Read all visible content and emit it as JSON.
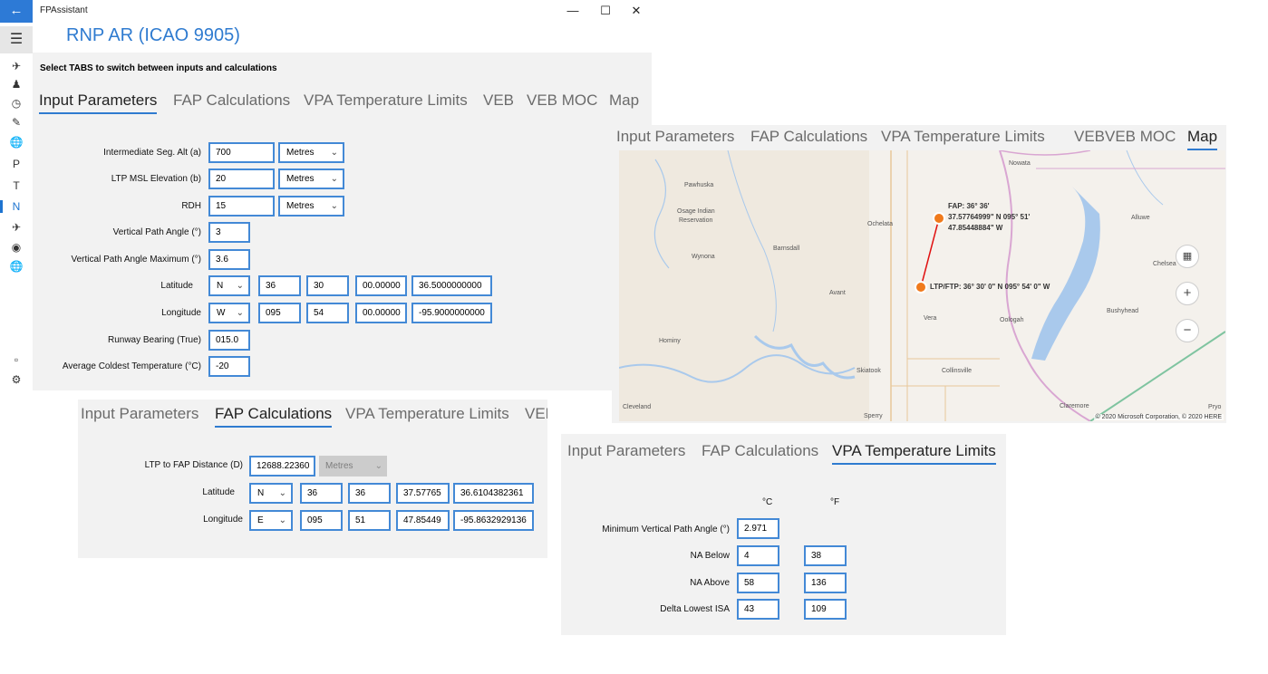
{
  "app": {
    "title": "FPAssistant",
    "page_title": "RNP AR (ICAO 9905)",
    "tabs_hint": "Select TABS to switch between inputs and calculations"
  },
  "tabs": [
    "Input Parameters",
    "FAP Calculations",
    "VPA Temperature Limits",
    "VEB",
    "VEB MOC",
    "Map"
  ],
  "nav": {
    "icons": [
      "airplane-icon",
      "person-icon",
      "gauge-icon",
      "ruler-icon",
      "globe-icon",
      "P",
      "T",
      "N",
      "plane-icon",
      "earth-icon",
      "globe-icon-2"
    ],
    "letters": {
      "p": "P",
      "t": "T",
      "n": "N"
    },
    "selected": "N"
  },
  "input_parameters": {
    "intermediate_alt": {
      "label": "Intermediate Seg. Alt (a)",
      "value": "700",
      "unit": "Metres"
    },
    "ltp_elevation": {
      "label": "LTP MSL Elevation (b)",
      "value": "20",
      "unit": "Metres"
    },
    "rdh": {
      "label": "RDH",
      "value": "15",
      "unit": "Metres"
    },
    "vpa": {
      "label": "Vertical Path Angle (°)",
      "value": "3"
    },
    "vpa_max": {
      "label": "Vertical Path Angle Maximum (°)",
      "value": "3.6"
    },
    "latitude": {
      "label": "Latitude",
      "hemi": "N",
      "deg": "36",
      "min": "30",
      "sec": "00.00000",
      "decimal": "36.5000000000"
    },
    "longitude": {
      "label": "Longitude",
      "hemi": "W",
      "deg": "095",
      "min": "54",
      "sec": "00.00000",
      "decimal": "-95.9000000000"
    },
    "runway_bearing": {
      "label": "Runway Bearing (True)",
      "value": "015.0"
    },
    "coldest_temp": {
      "label": "Average Coldest Temperature (°C)",
      "value": "-20"
    }
  },
  "fap_calculations": {
    "distance": {
      "label": "LTP to FAP Distance (D)",
      "value": "12688.22360",
      "unit": "Metres"
    },
    "latitude": {
      "label": "Latitude",
      "hemi": "N",
      "deg": "36",
      "min": "36",
      "sec": "37.57765",
      "decimal": "36.6104382361"
    },
    "longitude": {
      "label": "Longitude",
      "hemi": "E",
      "deg": "095",
      "min": "51",
      "sec": "47.85449",
      "decimal": "-95.8632929136"
    }
  },
  "vpa_temperature_limits": {
    "unit_c": "°C",
    "unit_f": "°F",
    "min_vpa": {
      "label": "Minimum Vertical Path Angle (°)",
      "c": "2.971"
    },
    "na_below": {
      "label": "NA Below",
      "c": "4",
      "f": "38"
    },
    "na_above": {
      "label": "NA Above",
      "c": "58",
      "f": "136"
    },
    "delta_isa": {
      "label": "Delta Lowest ISA",
      "c": "43",
      "f": "109"
    }
  },
  "map": {
    "fap_label": [
      "FAP: 36° 36'",
      "37.57764999\" N 095° 51'",
      "47.85448884\" W"
    ],
    "ltp_label": "LTP/FTP: 36° 30' 0\" N 095° 54' 0\" W",
    "places": {
      "nowata": "Nowata",
      "pawhuska": "Pawhuska",
      "osage": "Osage Indian",
      "reservation": "Reservation",
      "ochelata": "Ochelata",
      "alluwe": "Alluwe",
      "barnsdall": "Barnsdall",
      "wynona": "Wynona",
      "chelsea": "Chelsea",
      "avant": "Avant",
      "vera": "Vera",
      "oologah": "Oologah",
      "bushyhead": "Bushyhead",
      "hominy": "Hominy",
      "skiatook": "Skiatook",
      "collinsville": "Collinsville",
      "cleveland": "Cleveland",
      "sperry": "Sperry",
      "claremore": "Claremore",
      "pryor": "Pryo"
    },
    "copyright": "© 2020 Microsoft Corporation, © 2020 HERE",
    "colors": {
      "pin": "#f07a1c",
      "route": "#e01010",
      "lake": "#a9c9ec",
      "road": "#d9a6d2"
    }
  }
}
